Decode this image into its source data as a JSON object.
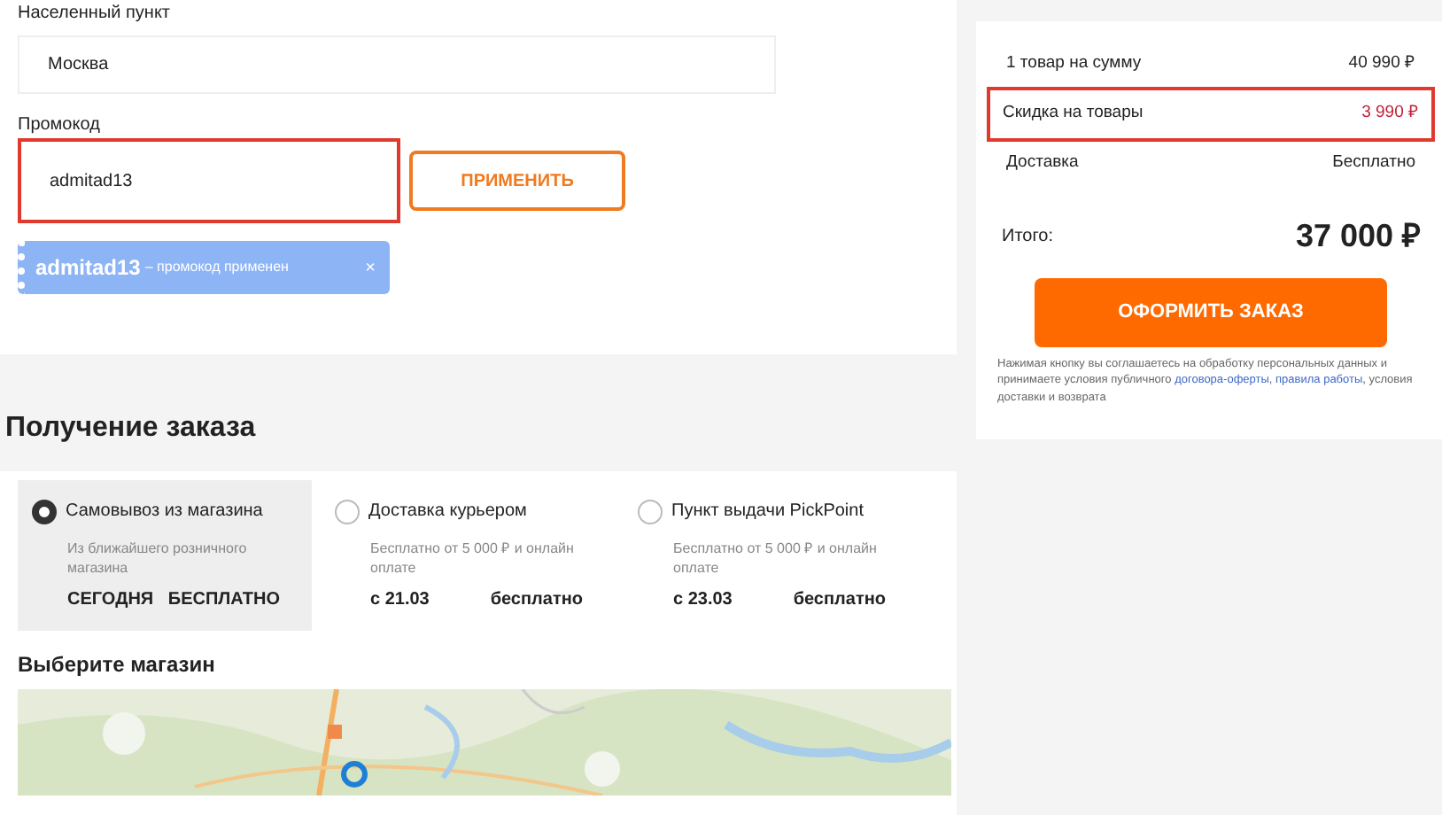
{
  "locality": {
    "label": "Населенный пункт",
    "value": "Москва"
  },
  "promo": {
    "label": "Промокод",
    "value": "admitad13",
    "highlighted": true,
    "button": "ПРИМЕНИТЬ"
  },
  "applied_promo": {
    "code": "admitad13",
    "note": "– промокод применен",
    "close": "×"
  },
  "summary": {
    "rows": [
      {
        "label": "1 товар на сумму",
        "value": "40 990 ₽",
        "kind": "plain",
        "highlighted": false
      },
      {
        "label": "Скидка на товары",
        "value": "3 990 ₽",
        "kind": "discount",
        "highlighted": true
      },
      {
        "label": "Доставка",
        "value": "Бесплатно",
        "kind": "plain",
        "highlighted": false
      }
    ],
    "total_label": "Итого:",
    "total_value": "37 000 ₽",
    "button": "ОФОРМИТЬ ЗАКАЗ",
    "disclaimer": [
      "Нажимая кнопку вы соглашаетесь на обработку персональных данных и принимаете условия публичного ",
      "договора-оферты",
      ", ",
      "правила работы",
      ", условия доставки и возврата"
    ]
  },
  "delivery": {
    "title": "Получение заказа",
    "options": [
      {
        "title": "Самовывоз из магазина",
        "note": "Из ближайшего розничного магазина",
        "date": "СЕГОДНЯ",
        "price": "БЕСПЛАТНО",
        "selected": true
      },
      {
        "title": "Доставка курьером",
        "note": "Бесплатно от 5 000 ₽ и онлайн оплате",
        "date": "с 21.03",
        "price": "бесплатно",
        "selected": false
      },
      {
        "title": "Пункт выдачи PickPoint",
        "note": "Бесплатно от 5 000 ₽ и онлайн оплате",
        "date": "с 23.03",
        "price": "бесплатно",
        "selected": false
      }
    ],
    "store_title": "Выберите магазин"
  }
}
